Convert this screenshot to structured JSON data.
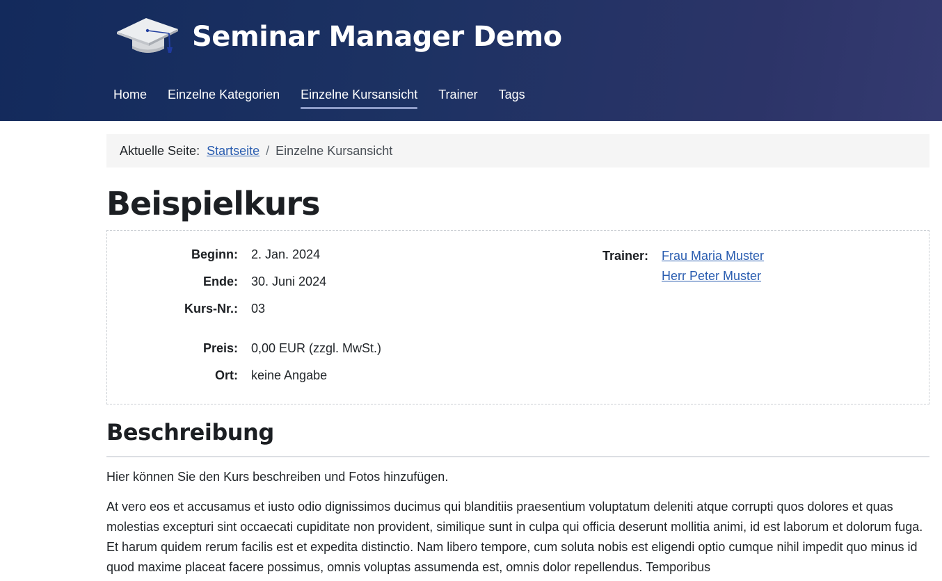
{
  "header": {
    "site_title": "Seminar Manager Demo",
    "logo_icon": "graduation-cap-icon",
    "nav": [
      {
        "label": "Home",
        "active": false
      },
      {
        "label": "Einzelne Kategorien",
        "active": false
      },
      {
        "label": "Einzelne Kursansicht",
        "active": true
      },
      {
        "label": "Trainer",
        "active": false
      },
      {
        "label": "Tags",
        "active": false
      }
    ]
  },
  "breadcrumb": {
    "prefix": "Aktuelle Seite:",
    "home_link": "Startseite",
    "separator": "/",
    "current": "Einzelne Kursansicht"
  },
  "course": {
    "title": "Beispielkurs",
    "details": {
      "begin_label": "Beginn:",
      "begin_value": "2. Jan. 2024",
      "end_label": "Ende:",
      "end_value": "30. Juni 2024",
      "number_label": "Kurs-Nr.:",
      "number_value": "03",
      "price_label": "Preis:",
      "price_value": "0,00 EUR (zzgl. MwSt.)",
      "location_label": "Ort:",
      "location_value": "keine Angabe"
    },
    "trainer_label": "Trainer:",
    "trainers": [
      "Frau Maria Muster",
      "Herr Peter Muster"
    ]
  },
  "description": {
    "heading": "Beschreibung",
    "intro": "Hier können Sie den Kurs beschreiben und Fotos hinzufügen.",
    "body": "At vero eos et accusamus et iusto odio dignissimos ducimus qui blanditiis praesentium voluptatum deleniti atque corrupti quos dolores et quas molestias excepturi sint occaecati cupiditate non provident, similique sunt in culpa qui officia deserunt mollitia animi, id est laborum et dolorum fuga. Et harum quidem rerum facilis est et expedita distinctio. Nam libero tempore, cum soluta nobis est eligendi optio cumque nihil impedit quo minus id quod maxime placeat facere possimus, omnis voluptas assumenda est, omnis dolor repellendus. Temporibus"
  },
  "colors": {
    "header_bg": "#1d3263",
    "link": "#2a5db0",
    "breadcrumb_bg": "#f5f5f5"
  }
}
